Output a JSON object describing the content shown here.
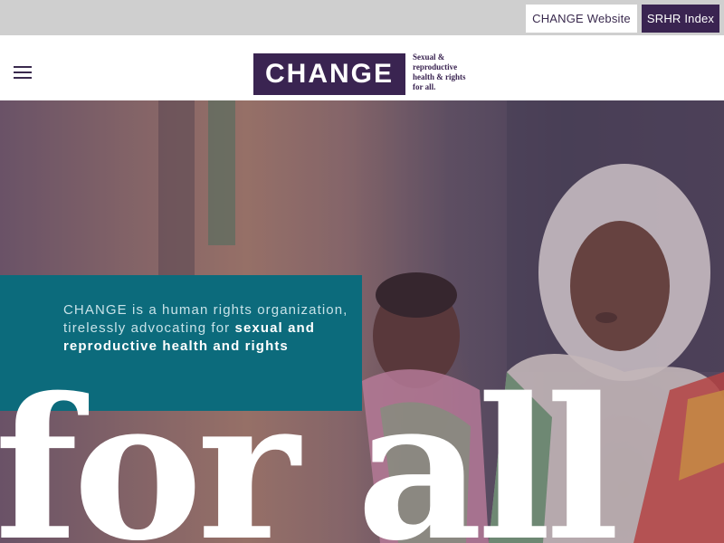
{
  "topbar": {
    "change_website": "CHANGE Website",
    "srhr_index": "SRHR Index"
  },
  "header": {
    "logo_text": "CHANGE",
    "logo_tagline": [
      "Sexual &",
      "reproductive",
      "health & rights",
      "for all."
    ]
  },
  "hero": {
    "tagline_plain": "CHANGE is a human rights organization, tirelessly advocating for ",
    "tagline_bold": "sexual and reproductive health and rights",
    "big_text": "for all"
  },
  "icons": {
    "menu": "hamburger-menu-icon"
  },
  "colors": {
    "brand_purple": "#3a2451",
    "teal": "#0c6b7c",
    "topbar_gray": "#cfcfcf"
  }
}
